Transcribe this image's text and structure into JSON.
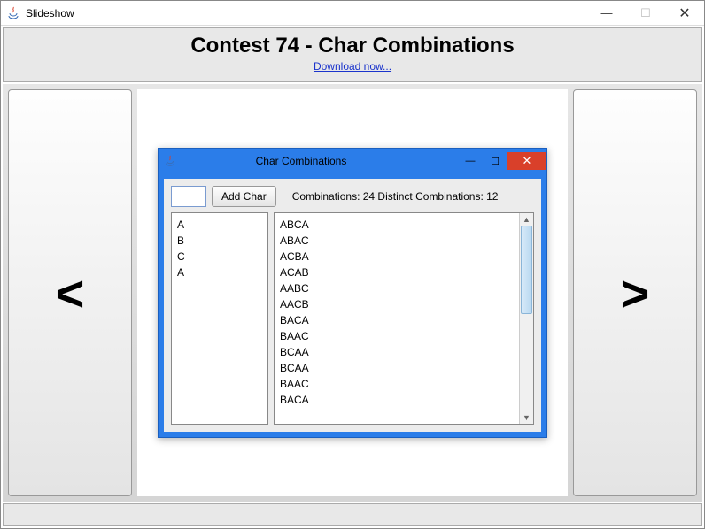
{
  "outer": {
    "title": "Slideshow",
    "min": "—",
    "max": "☐",
    "close": "✕"
  },
  "header": {
    "title": "Contest 74 - Char Combinations",
    "download": "Download now..."
  },
  "nav": {
    "prev": "<",
    "next": ">"
  },
  "inner": {
    "title": "Char Combinations",
    "min": "—",
    "max": "☐",
    "close": "✕",
    "input_value": "",
    "add_button": "Add Char",
    "stats": "Combinations: 24 Distinct Combinations: 12",
    "chars": [
      "A",
      "B",
      "C",
      "A"
    ],
    "results": [
      "ABCA",
      "ABAC",
      "ACBA",
      "ACAB",
      "AABC",
      "AACB",
      "BACA",
      "BAAC",
      "BCAA",
      "BCAA",
      "BAAC",
      "BACA"
    ]
  }
}
